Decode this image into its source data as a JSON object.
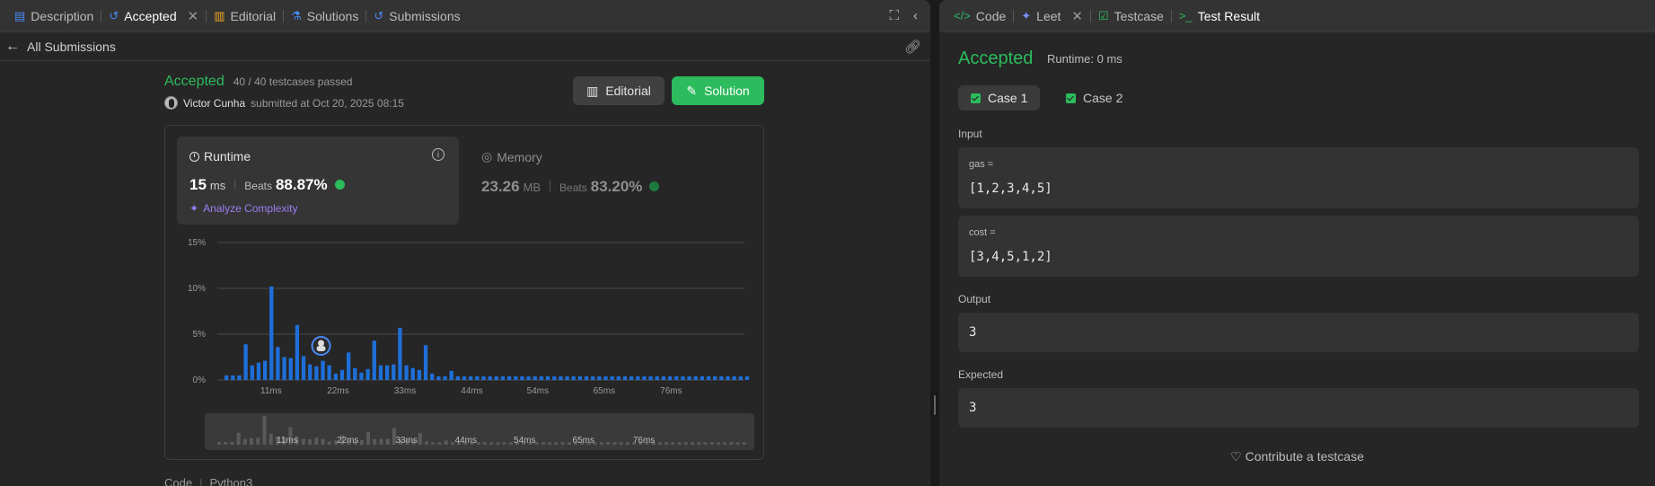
{
  "left_tabs": [
    {
      "label": "Description",
      "icon": "doc-icon",
      "color": "#4a8af4"
    },
    {
      "label": "Accepted",
      "icon": "history-icon",
      "color": "#4a8af4",
      "closable": true
    },
    {
      "label": "Editorial",
      "icon": "book-icon",
      "color": "#f0a824"
    },
    {
      "label": "Solutions",
      "icon": "flask-icon",
      "color": "#4a8af4"
    },
    {
      "label": "Submissions",
      "icon": "history-icon",
      "color": "#4a8af4"
    }
  ],
  "subheader": {
    "back_label": "All Submissions"
  },
  "submission": {
    "status": "Accepted",
    "testcases": "40 / 40 testcases passed",
    "author": "Victor Cunha",
    "submitted_at": "submitted at Oct 20, 2025 08:15",
    "editorial_btn": "Editorial",
    "solution_btn": "Solution"
  },
  "runtime": {
    "title": "Runtime",
    "value": "15",
    "unit": "ms",
    "beats_label": "Beats",
    "beats": "88.87%",
    "analyze": "Analyze Complexity"
  },
  "memory": {
    "title": "Memory",
    "value": "23.26",
    "unit": "MB",
    "beats_label": "Beats",
    "beats": "83.20%"
  },
  "code_label": {
    "label": "Code",
    "lang": "Python3"
  },
  "right_tabs": [
    {
      "label": "Code",
      "icon": "code-icon",
      "color": "#2cbb5d"
    },
    {
      "label": "Leet",
      "icon": "sparkle-icon",
      "color": "#7b8ef7",
      "closable": true
    },
    {
      "label": "Testcase",
      "icon": "checkbox-icon",
      "color": "#2cbb5d"
    },
    {
      "label": "Test Result",
      "icon": "terminal-icon",
      "color": "#2cbb5d"
    }
  ],
  "result": {
    "status": "Accepted",
    "runtime": "Runtime: 0 ms",
    "cases": [
      "Case 1",
      "Case 2"
    ],
    "input_label": "Input",
    "inputs": [
      {
        "name": "gas =",
        "value": "[1,2,3,4,5]"
      },
      {
        "name": "cost =",
        "value": "[3,4,5,1,2]"
      }
    ],
    "output_label": "Output",
    "output": "3",
    "expected_label": "Expected",
    "expected": "3",
    "contribute": "Contribute a testcase"
  },
  "chart_data": {
    "type": "bar",
    "title": "",
    "xlabel": "",
    "ylabel": "",
    "yticks": [
      "15%",
      "10%",
      "5%",
      "0%"
    ],
    "ylim": [
      0,
      15
    ],
    "xticks": [
      "11ms",
      "22ms",
      "33ms",
      "44ms",
      "54ms",
      "65ms",
      "76ms"
    ],
    "nav_xticks": [
      "11ms",
      "22ms",
      "33ms",
      "44ms",
      "54ms",
      "65ms",
      "76ms"
    ],
    "values": [
      0.5,
      0.5,
      0.5,
      3.9,
      1.6,
      1.9,
      2.1,
      10.2,
      3.6,
      2.5,
      2.4,
      6.0,
      2.6,
      1.7,
      1.5,
      2.1,
      1.6,
      0.7,
      1.1,
      3.0,
      1.3,
      0.8,
      1.2,
      4.3,
      1.6,
      1.6,
      1.7,
      5.7,
      1.6,
      1.3,
      1.1,
      3.8,
      0.7,
      0.4,
      0.4,
      1.0,
      0.4,
      0.4,
      0.4,
      0.4,
      0.4,
      0.4,
      0.4,
      0.4,
      0.4,
      0.4,
      0.4,
      0.4,
      0.4,
      0.4,
      0.4,
      0.4,
      0.4,
      0.4,
      0.4,
      0.4,
      0.4,
      0.4,
      0.4,
      0.4,
      0.4,
      0.4,
      0.4,
      0.4,
      0.4,
      0.4,
      0.4,
      0.4,
      0.4,
      0.4,
      0.4,
      0.4,
      0.4,
      0.4,
      0.4,
      0.4,
      0.4,
      0.4,
      0.4,
      0.4,
      0.4,
      0.4
    ],
    "highlight_index": 15,
    "bar_color": "#1e6fd9",
    "nav_color": "#5a5a5a"
  }
}
